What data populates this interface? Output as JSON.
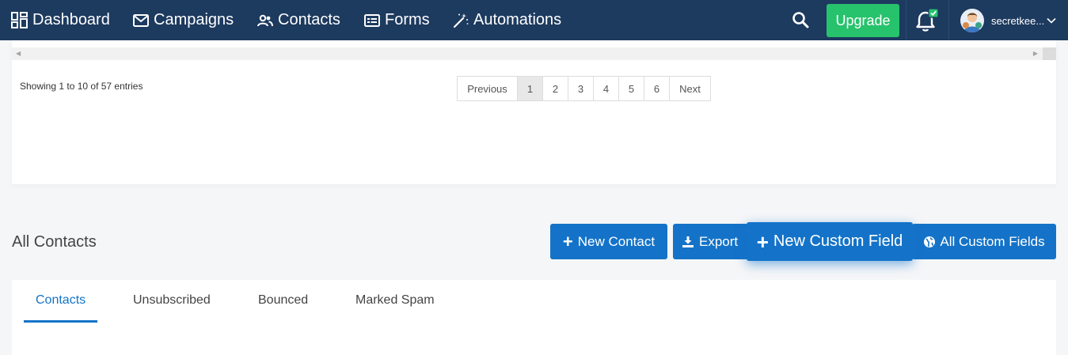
{
  "nav": {
    "items": [
      {
        "label": "Dashboard",
        "icon": "dashboard-icon"
      },
      {
        "label": "Campaigns",
        "icon": "envelope-icon"
      },
      {
        "label": "Contacts",
        "icon": "users-icon"
      },
      {
        "label": "Forms",
        "icon": "form-icon"
      },
      {
        "label": "Automations",
        "icon": "magic-wand-icon"
      }
    ],
    "upgrade_label": "Upgrade",
    "username": "secretkee...",
    "colors": {
      "bar": "#1d3a5f",
      "upgrade": "#27c26c",
      "notification_badge": "#27c26c"
    }
  },
  "table_footer": {
    "entries_info": "Showing 1 to 10 of 57 entries",
    "pagination": {
      "previous": "Previous",
      "pages": [
        "1",
        "2",
        "3",
        "4",
        "5",
        "6"
      ],
      "active_page": "1",
      "next": "Next"
    }
  },
  "contacts_section": {
    "title": "All Contacts",
    "buttons": {
      "new_contact": "New Contact",
      "export": "Export",
      "new_custom_field": "New Custom Field",
      "all_custom_fields": "All Custom Fields"
    },
    "accent_color": "#1473c8"
  },
  "tabs": [
    {
      "label": "Contacts",
      "active": true
    },
    {
      "label": "Unsubscribed",
      "active": false
    },
    {
      "label": "Bounced",
      "active": false
    },
    {
      "label": "Marked Spam",
      "active": false
    }
  ]
}
